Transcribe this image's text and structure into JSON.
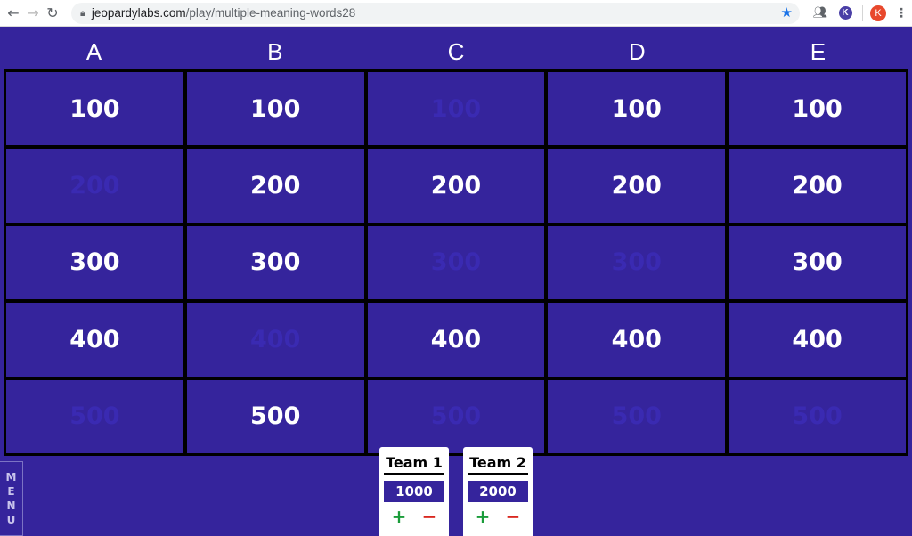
{
  "browser": {
    "url_domain": "jeopardylabs.com",
    "url_path": "/play/multiple-meaning-words28",
    "profile_initial": "K",
    "extension_initial": "K"
  },
  "board": {
    "categories": [
      "A",
      "B",
      "C",
      "D",
      "E"
    ],
    "rows": [
      [
        {
          "value": "100",
          "used": false
        },
        {
          "value": "100",
          "used": false
        },
        {
          "value": "100",
          "used": true
        },
        {
          "value": "100",
          "used": false
        },
        {
          "value": "100",
          "used": false
        }
      ],
      [
        {
          "value": "200",
          "used": true
        },
        {
          "value": "200",
          "used": false
        },
        {
          "value": "200",
          "used": false
        },
        {
          "value": "200",
          "used": false
        },
        {
          "value": "200",
          "used": false
        }
      ],
      [
        {
          "value": "300",
          "used": false
        },
        {
          "value": "300",
          "used": false
        },
        {
          "value": "300",
          "used": true
        },
        {
          "value": "300",
          "used": true
        },
        {
          "value": "300",
          "used": false
        }
      ],
      [
        {
          "value": "400",
          "used": false
        },
        {
          "value": "400",
          "used": true
        },
        {
          "value": "400",
          "used": false
        },
        {
          "value": "400",
          "used": false
        },
        {
          "value": "400",
          "used": false
        }
      ],
      [
        {
          "value": "500",
          "used": true
        },
        {
          "value": "500",
          "used": false
        },
        {
          "value": "500",
          "used": true
        },
        {
          "value": "500",
          "used": true
        },
        {
          "value": "500",
          "used": true
        }
      ]
    ]
  },
  "menu": {
    "letters": [
      "M",
      "E",
      "N",
      "U"
    ]
  },
  "teams": [
    {
      "name": "Team 1",
      "score": "1000",
      "plus": "+",
      "minus": "−"
    },
    {
      "name": "Team 2",
      "score": "2000",
      "plus": "+",
      "minus": "−"
    }
  ],
  "colors": {
    "board_bg": "#35249c",
    "used_text": "#3a2ab2",
    "plus": "#1a9c3a",
    "minus": "#d9271f"
  }
}
